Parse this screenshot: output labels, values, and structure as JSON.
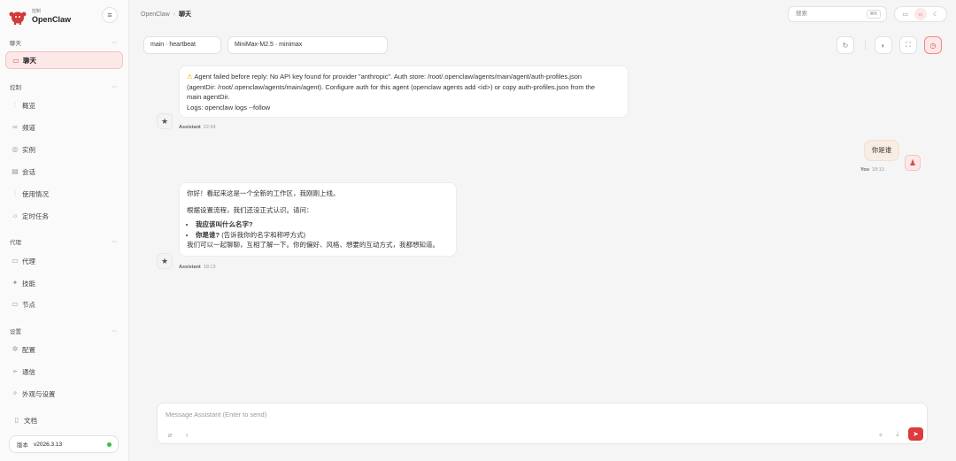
{
  "app": {
    "logo_sub": "控制",
    "name": "OpenClaw",
    "collapse_icon": "menu-icon"
  },
  "sidebar": {
    "sections": [
      {
        "title": "聊天",
        "items": [
          {
            "label": "聊天",
            "icon": "chat-icon",
            "active": true
          }
        ]
      },
      {
        "title": "控制",
        "items": [
          {
            "label": "概览",
            "icon": "bar-chart-icon"
          },
          {
            "label": "频道",
            "icon": "link-icon"
          },
          {
            "label": "实例",
            "icon": "radio-icon"
          },
          {
            "label": "会话",
            "icon": "document-icon"
          },
          {
            "label": "使用情况",
            "icon": "chart-icon"
          },
          {
            "label": "定时任务",
            "icon": "clock-icon"
          }
        ]
      },
      {
        "title": "代理",
        "items": [
          {
            "label": "代理",
            "icon": "folder-icon"
          },
          {
            "label": "技能",
            "icon": "sparkle-icon"
          },
          {
            "label": "节点",
            "icon": "monitor-icon"
          }
        ]
      },
      {
        "title": "设置",
        "items": [
          {
            "label": "配置",
            "icon": "gear-icon"
          },
          {
            "label": "通信",
            "icon": "send-icon"
          },
          {
            "label": "外观与设置",
            "icon": "palette-icon"
          }
        ]
      }
    ],
    "docs_label": "文档",
    "version_label": "版本",
    "version_value": "v2026.3.13",
    "status_color": "#3fb950"
  },
  "topbar": {
    "breadcrumb_root": "OpenClaw",
    "breadcrumb_sep": "›",
    "breadcrumb_current": "聊天",
    "search_placeholder": "搜索",
    "search_shortcut": "⌘K"
  },
  "session": {
    "session_chip": "main · heartbeat",
    "model_chip": "MiniMax-M2.5 · minimax"
  },
  "messages": {
    "error": {
      "line1": "Agent failed before reply: No API key found for provider \"anthropic\". Auth store: /root/.openclaw/agents/main/agent/auth-profiles.json",
      "line2": "(agentDir: /root/.openclaw/agents/main/agent). Configure auth for this agent (openclaw agents add <id>) or copy auth-profiles.json from the",
      "line3": "main agentDir.",
      "line4": "Logs: openclaw logs --follow",
      "sender": "Assistant",
      "time": "22:34"
    },
    "user": {
      "text": "你是谁",
      "sender": "You",
      "time": "18:13"
    },
    "reply": {
      "p1": "你好！看起来这是一个全新的工作区，我刚刚上线。",
      "p2": "根据设置流程，我们还没正式认识。请问：",
      "b1": "我应该叫什么名字?",
      "b2_bold": "你是谁?",
      "b2_rest": "(告诉我你的名字和称呼方式)",
      "p3": "我们可以一起聊聊，互相了解一下。你的偏好、风格、想要的互动方式，我都想知道。",
      "sender": "Assistant",
      "time": "18:13"
    }
  },
  "composer": {
    "placeholder": "Message Assistant (Enter to send)"
  },
  "colors": {
    "accent": "#dc3c3c",
    "accent_soft": "#fde8e8"
  }
}
